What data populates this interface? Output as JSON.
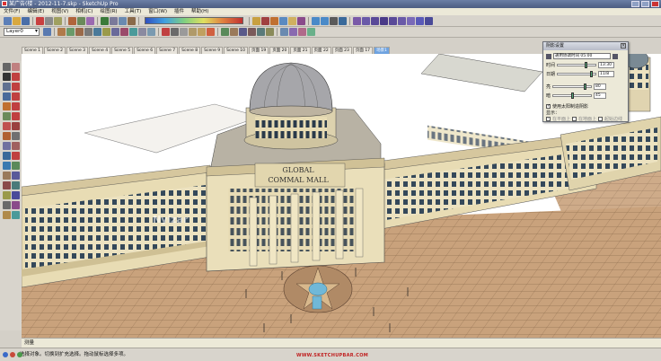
{
  "window": {
    "title": "某广告(楼 - 2012-11-7.skp - SketchUp Pro"
  },
  "menu": [
    "文件(F)",
    "编辑(E)",
    "视图(V)",
    "相机(C)",
    "绘图(R)",
    "工具(T)",
    "窗口(W)",
    "插件",
    "帮助(H)"
  ],
  "toolbar": {
    "layer_value": "Layer0"
  },
  "scene_tabs": [
    "Scene 1",
    "Scene 2",
    "Scene 3",
    "Scene 4",
    "Scene 5",
    "Scene 6",
    "Scene 7",
    "Scene 8",
    "Scene 9",
    "Scene 10",
    "页面 19",
    "页面 20",
    "页面 21",
    "页面 22",
    "页面 23",
    "页面 17",
    "场景1"
  ],
  "active_scene_index": 16,
  "building": {
    "sign_line1": "GLOBAL",
    "sign_line2": "COMMAL MALL"
  },
  "viewport_watermark": "Nyizar",
  "shadow_dialog": {
    "title": "阴影设置",
    "timezone": "通用协调时间 05:00",
    "time_label": "时间",
    "time_value": "13:30",
    "date_label": "日期",
    "date_value": "11/8",
    "light_label": "亮",
    "light_value": "80",
    "dark_label": "暗",
    "dark_value": "45",
    "use_sun_label": "使用太阳制造阴影",
    "display_label": "显示：",
    "on_faces_label": "在平面上",
    "on_ground_label": "在地面上",
    "from_edges_label": "起始边线"
  },
  "measure_label": "测量",
  "status_text": "选择对象。切换到扩充选择。拖动鼠标选择多项。",
  "footer_watermark": "WWW.SKETCHUPBAR.COM",
  "colors": {
    "plaza": "#c8a07a",
    "facade": "#e8dcb4",
    "dome": "#a8a8aa",
    "sky": "#ffffff",
    "active_tab": "#6fa3e0"
  }
}
